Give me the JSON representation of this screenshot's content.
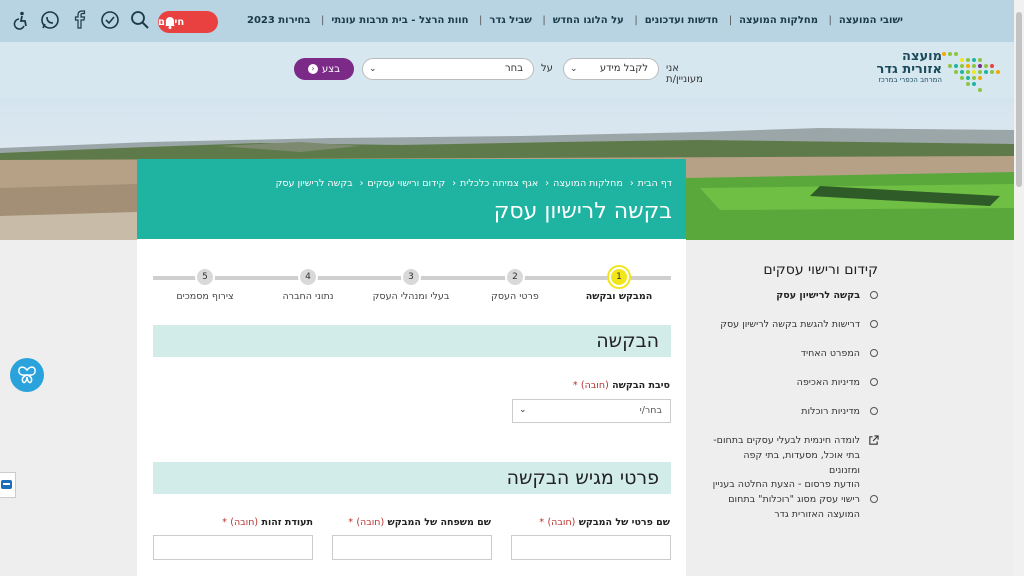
{
  "topnav": {
    "items": [
      "ישובי המועצה",
      "מחלקות המועצה",
      "חדשות ועדכונים",
      "על הלוגו החדש",
      "שביל גדר",
      "חוות הרצל - בית תרבות עונתי",
      "בחירות 2023"
    ],
    "alarm_label": "חירום"
  },
  "header": {
    "logo": {
      "line1": "מועצה",
      "line2": "אזורית גדר",
      "tagline": "המרחב הכפרי במרכז"
    },
    "search": {
      "interest_label": "אני מעוניין/ת",
      "select1_value": "לקבל מידע",
      "on_label": "על",
      "select2_value": "בחר",
      "go_label": "בצע"
    }
  },
  "breadcrumb": [
    "דף הבית",
    "מחלקות המועצה",
    "אגף צמיחה כלכלית",
    "קידום ורישוי עסקים",
    "בקשה לרישיון עסק"
  ],
  "page_title": "בקשה לרישיון עסק",
  "stepper": [
    {
      "num": "1",
      "label": "המבקש ובקשה",
      "active": true
    },
    {
      "num": "2",
      "label": "פרטי העסק"
    },
    {
      "num": "3",
      "label": "בעלי ומנהלי העסק"
    },
    {
      "num": "4",
      "label": "נתוני החברה"
    },
    {
      "num": "5",
      "label": "צירוף מסמכים"
    }
  ],
  "form": {
    "section1_title": "הבקשה",
    "reason_label": "סיבת הבקשה",
    "required_text": "(חובה)",
    "reason_placeholder": "בחר/י",
    "section2_title": "פרטי מגיש הבקשה",
    "first_name_label": "שם פרטי של המבקש",
    "last_name_label": "שם משפחה של המבקש",
    "id_label": "תעודת זהות"
  },
  "sidebar": {
    "title": "קידום ורישוי עסקים",
    "items": [
      "בקשה לרישיון עסק",
      "דרישות להגשת בקשה לרישיון עסק",
      "המפרט האחיד",
      "מדיניות האכיפה",
      "מדיניות רוכלות",
      "לומדה חינמית לבעלי עסקים בתחום- בתי אוכל, מסעדות, בתי קפה ומזנונים",
      "הודעת פרסום - הצעת החלטה בעניין רישוי עסק מסוג \"רוכלות\" בתחום המועצה האזורית גדר"
    ]
  },
  "colors": {
    "teal": "#1fb3a2",
    "purple": "#7b2a87",
    "alarm": "#e94040",
    "step_active": "#f2e61b"
  },
  "icons": [
    "accessibility-icon",
    "whatsapp-icon",
    "facebook-icon",
    "clock-check-icon",
    "search-icon",
    "bell-icon",
    "external-link-icon",
    "butterfly-icon"
  ]
}
